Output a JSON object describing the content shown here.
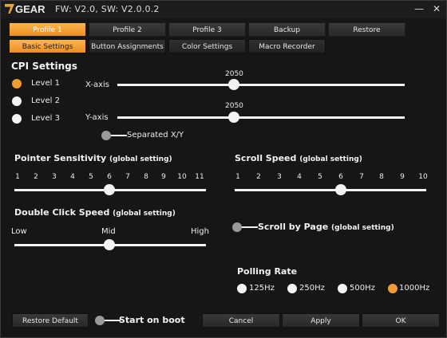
{
  "window": {
    "logo_text": "GEAR",
    "title": "FW: V2.0, SW: V2.0.0.2",
    "minimize_glyph": "—",
    "close_glyph": "✕"
  },
  "profile_tabs": [
    {
      "label": "Profile 1",
      "active": true
    },
    {
      "label": "Profile 2",
      "active": false
    },
    {
      "label": "Profile 3",
      "active": false
    },
    {
      "label": "Backup",
      "active": false
    },
    {
      "label": "Restore",
      "active": false
    }
  ],
  "sub_tabs": [
    {
      "label": "Basic Settings",
      "active": true
    },
    {
      "label": "Button Assignments",
      "active": false
    },
    {
      "label": "Color Settings",
      "active": false
    },
    {
      "label": "Macro Recorder",
      "active": false
    }
  ],
  "cpi": {
    "title": "CPI Settings",
    "levels": [
      {
        "label": "Level 1",
        "selected": true
      },
      {
        "label": "Level 2",
        "selected": false
      },
      {
        "label": "Level 3",
        "selected": false
      }
    ],
    "x_axis": {
      "label": "X-axis",
      "value_text": "2050",
      "value": 2050
    },
    "y_axis": {
      "label": "Y-axis",
      "value_text": "2050",
      "value": 2050
    },
    "separated_label": "Separated X/Y",
    "separated_on": false
  },
  "pointer_sensitivity": {
    "title": "Pointer Sensitivity",
    "subtitle": "(global setting)",
    "ticks": [
      "1",
      "2",
      "3",
      "4",
      "5",
      "6",
      "7",
      "8",
      "9",
      "10",
      "11"
    ],
    "value": 6
  },
  "scroll_speed": {
    "title": "Scroll Speed",
    "subtitle": "(global setting)",
    "ticks": [
      "1",
      "2",
      "3",
      "4",
      "5",
      "6",
      "7",
      "8",
      "9",
      "10"
    ],
    "value": 6
  },
  "double_click": {
    "title": "Double Click Speed",
    "subtitle": "(global setting)",
    "low_label": "Low",
    "mid_label": "Mid",
    "high_label": "High",
    "value": "Mid"
  },
  "scroll_by_page": {
    "label": "Scroll by Page",
    "subtitle": "(global setting)",
    "on": false
  },
  "polling_rate": {
    "title": "Polling Rate",
    "options": [
      {
        "label": "125Hz",
        "selected": false
      },
      {
        "label": "250Hz",
        "selected": false
      },
      {
        "label": "500Hz",
        "selected": false
      },
      {
        "label": "1000Hz",
        "selected": true
      }
    ]
  },
  "footer": {
    "restore_default": "Restore Default",
    "start_on_boot": "Start on boot",
    "start_on_boot_on": false,
    "cancel": "Cancel",
    "apply": "Apply",
    "ok": "OK"
  },
  "colors": {
    "accent": "#f19a34",
    "background": "#161616"
  }
}
